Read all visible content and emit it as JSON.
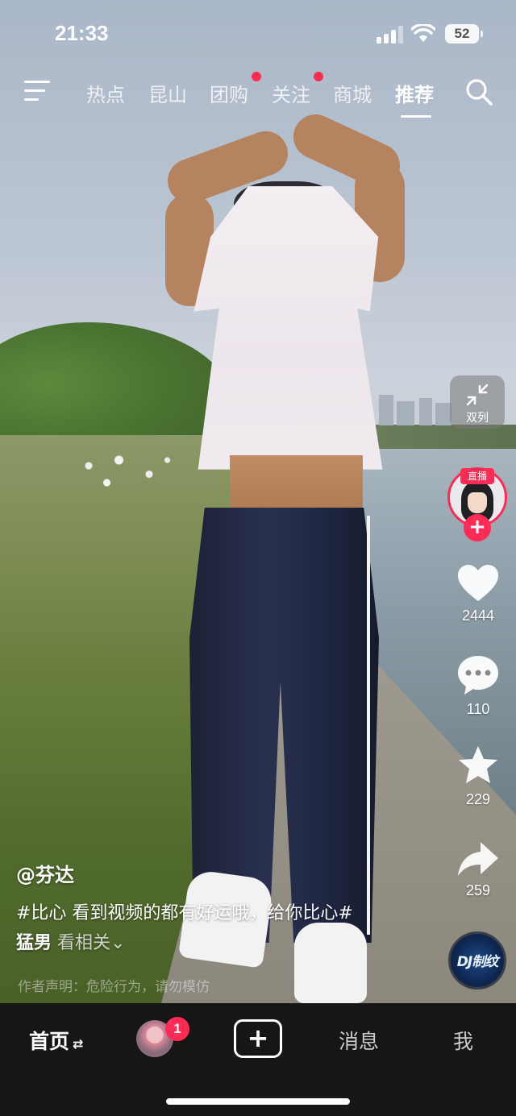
{
  "status_bar": {
    "time": "21:33",
    "battery": "52"
  },
  "top_nav": {
    "tabs": [
      {
        "label": "热点"
      },
      {
        "label": "昆山"
      },
      {
        "label": "团购",
        "has_dot": true
      },
      {
        "label": "关注",
        "has_dot": true
      },
      {
        "label": "商城"
      },
      {
        "label": "推荐",
        "active": true
      }
    ]
  },
  "right_rail": {
    "dual_column_label": "双列",
    "live_badge": "直播",
    "follow_plus": "+",
    "like_count": "2444",
    "comment_count": "110",
    "favorite_count": "229",
    "share_count": "259",
    "music_disc_text": "DJ制纹"
  },
  "caption": {
    "author": "@芬达",
    "text_line1": "#比心 看到视频的都有好运哦，给你比心#",
    "text_line2_tag": "猛男",
    "text_line2_more": "看相关⌄",
    "disclaimer": "作者声明：危险行为，请勿模仿"
  },
  "bottom_nav": {
    "home": "首页",
    "home_swap": "⇄",
    "friend_badge": "1",
    "create": "+",
    "messages": "消息",
    "me": "我"
  },
  "colors": {
    "accent": "#fe2c55",
    "bottom_bar": "#161616"
  }
}
